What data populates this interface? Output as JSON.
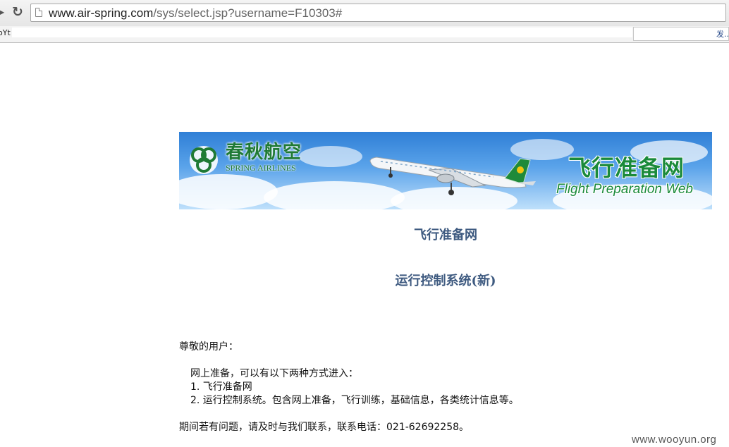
{
  "browser": {
    "url_host": "www.air-spring.com",
    "url_path": "/sys/select.jsp?username=F10303#",
    "bookmark_text": "oYt",
    "bookmark_more": "发..."
  },
  "banner": {
    "logo_cn": "春秋航空",
    "logo_en": "SPRING AIRLINES",
    "title_cn": "飞行准备网",
    "title_en": "Flight Preparation Web",
    "colors": {
      "green": "#1a8a3a",
      "sky": "#4d9ae6"
    }
  },
  "links": {
    "prep": "飞行准备网",
    "ops": "运行控制系统(新)"
  },
  "content": {
    "greeting": "尊敬的用户：",
    "intro": "网上准备，可以有以下两种方式进入：",
    "items": [
      "1. 飞行准备网",
      "2. 运行控制系统。包含网上准备，飞行训练，基础信息，各类统计信息等。"
    ],
    "contact": "期间若有问题，请及时与我们联系，联系电话：021-62692258。"
  },
  "watermark": "www.wooyun.org"
}
